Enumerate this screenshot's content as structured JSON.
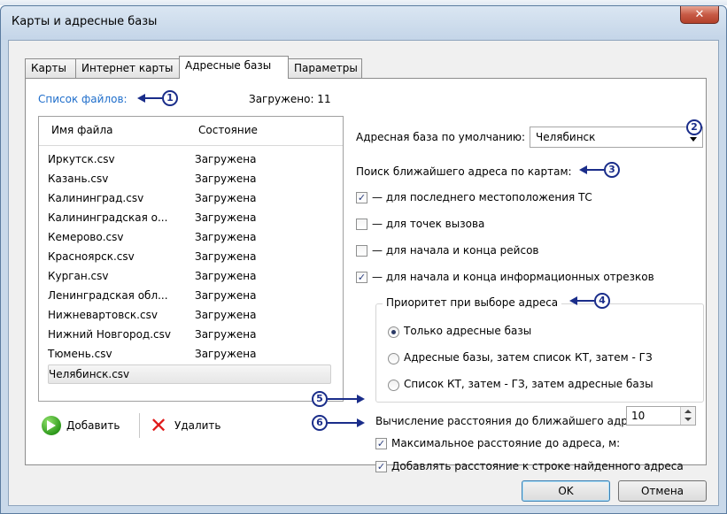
{
  "window": {
    "title": "Карты и адресные базы",
    "close_glyph": "✕"
  },
  "tabs": [
    {
      "label": "Карты",
      "active": false
    },
    {
      "label": "Интернет карты",
      "active": false
    },
    {
      "label": "Адресные базы",
      "active": true
    },
    {
      "label": "Параметры",
      "active": false
    }
  ],
  "file_list": {
    "title": "Список файлов:",
    "loaded_label": "Загружено: 11",
    "columns": [
      "Имя файла",
      "Состояние"
    ],
    "rows": [
      {
        "name": "Иркутск.csv",
        "status": "Загружена"
      },
      {
        "name": "Казань.csv",
        "status": "Загружена"
      },
      {
        "name": "Калининград.csv",
        "status": "Загружена"
      },
      {
        "name": "Калининградская о...",
        "status": "Загружена"
      },
      {
        "name": "Кемерово.csv",
        "status": "Загружена"
      },
      {
        "name": "Красноярск.csv",
        "status": "Загружена"
      },
      {
        "name": "Курган.csv",
        "status": "Загружена"
      },
      {
        "name": "Ленинградская обл...",
        "status": "Загружена"
      },
      {
        "name": "Нижневартовск.csv",
        "status": "Загружена"
      },
      {
        "name": "Нижний Новгород.csv",
        "status": "Загружена"
      },
      {
        "name": "Тюмень.csv",
        "status": "Загружена"
      },
      {
        "name": "Челябинск.csv",
        "status": ""
      }
    ],
    "add_label": "Добавить",
    "delete_label": "Удалить"
  },
  "default_base": {
    "label": "Адресная база по умолчанию:",
    "value": "Челябинск"
  },
  "nearest_search": {
    "heading": "Поиск ближайшего адреса по картам:",
    "options": [
      {
        "label": "— для последнего местоположения ТС",
        "checked": true
      },
      {
        "label": "— для точек вызова",
        "checked": false
      },
      {
        "label": "— для начала и конца рейсов",
        "checked": false
      },
      {
        "label": "— для начала и конца информационных отрезков",
        "checked": true
      }
    ]
  },
  "priority": {
    "legend": "Приоритет при выборе адреса",
    "options": [
      {
        "label": "Только адресные базы",
        "selected": true
      },
      {
        "label": "Адресные базы, затем список КТ, затем - ГЗ",
        "selected": false
      },
      {
        "label": "Список КТ, затем - ГЗ, затем адресные базы",
        "selected": false
      }
    ]
  },
  "distance": {
    "heading": "Вычисление расстояния до ближайшего адреса:",
    "max_label": "Максимальное расстояние до адреса, м:",
    "max_checked": true,
    "max_value": "10",
    "append_label": "Добавлять расстояние к строке найденного адреса",
    "append_checked": true
  },
  "callouts": [
    "1",
    "2",
    "3",
    "4",
    "5",
    "6"
  ],
  "buttons": {
    "ok": "OK",
    "cancel": "Отмена"
  },
  "colors": {
    "link": "#1f6ecb",
    "callout": "#1a2d8a",
    "title_bar": "#c4d5e8",
    "close": "#c75a45"
  }
}
